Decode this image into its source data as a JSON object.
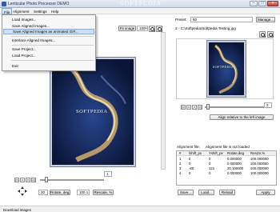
{
  "window": {
    "title": "Lenticular Photo Processor DEMO",
    "watermark": "SOFTPEDIA",
    "minimize": "–",
    "maximize": "□",
    "close": "×"
  },
  "menu": {
    "file": "File",
    "alignment": "Alignment",
    "settings": "Settings",
    "help": "Help"
  },
  "file_menu": {
    "items": [
      "Load Images...",
      "Save Aligned Images...",
      "Save Aligned Images as animated GIF...",
      "Interlace Aligned Images...",
      "Save Project...",
      "Load Project...",
      "Exit"
    ],
    "highlighted_index": 2
  },
  "left_panel": {
    "fit_image": "Fit image",
    "zoom_value": "100%",
    "nav_value": "1",
    "image_watermark": "SOFTPEDIA",
    "rotate_value": "20",
    "rotate_label": "Rotate, deg.",
    "rescale_value": "100.1",
    "rescale_label": "Rescale, %"
  },
  "right_panel": {
    "preset_label": "Preset:",
    "preset_value": "60",
    "manage": "Manage...",
    "image_path": "2 - C:\\Softpedia\\Softpedia Testing.jpg",
    "image_watermark": "SOFTPEDIA",
    "nav_value": "2",
    "align_button": "Align relative to the left image",
    "alignment_file_label": "Alignment file:",
    "alignment_file_value": "Alignment file is not loaded",
    "table": {
      "columns": [
        "#",
        "fshift_px",
        "Yshift_px",
        "Rotate,deg",
        "Resize,%"
      ],
      "rows": [
        [
          "1",
          "0",
          "0",
          "0.000000",
          "100.000000"
        ],
        [
          "2",
          "0",
          "0",
          "0.000000",
          "100.000000"
        ],
        [
          "3",
          "-85",
          "121",
          "20.100000",
          "100.000000"
        ],
        [
          "4",
          "0",
          "0",
          "0.000000",
          "100.000000"
        ]
      ]
    },
    "save": "Save...",
    "load": "Load...",
    "reload": "Reload",
    "apply": "Apply"
  },
  "status": {
    "text": "Download images"
  },
  "nav_arrows": {
    "first": "|<",
    "prev": "<",
    "next": ">",
    "last": ">|"
  }
}
